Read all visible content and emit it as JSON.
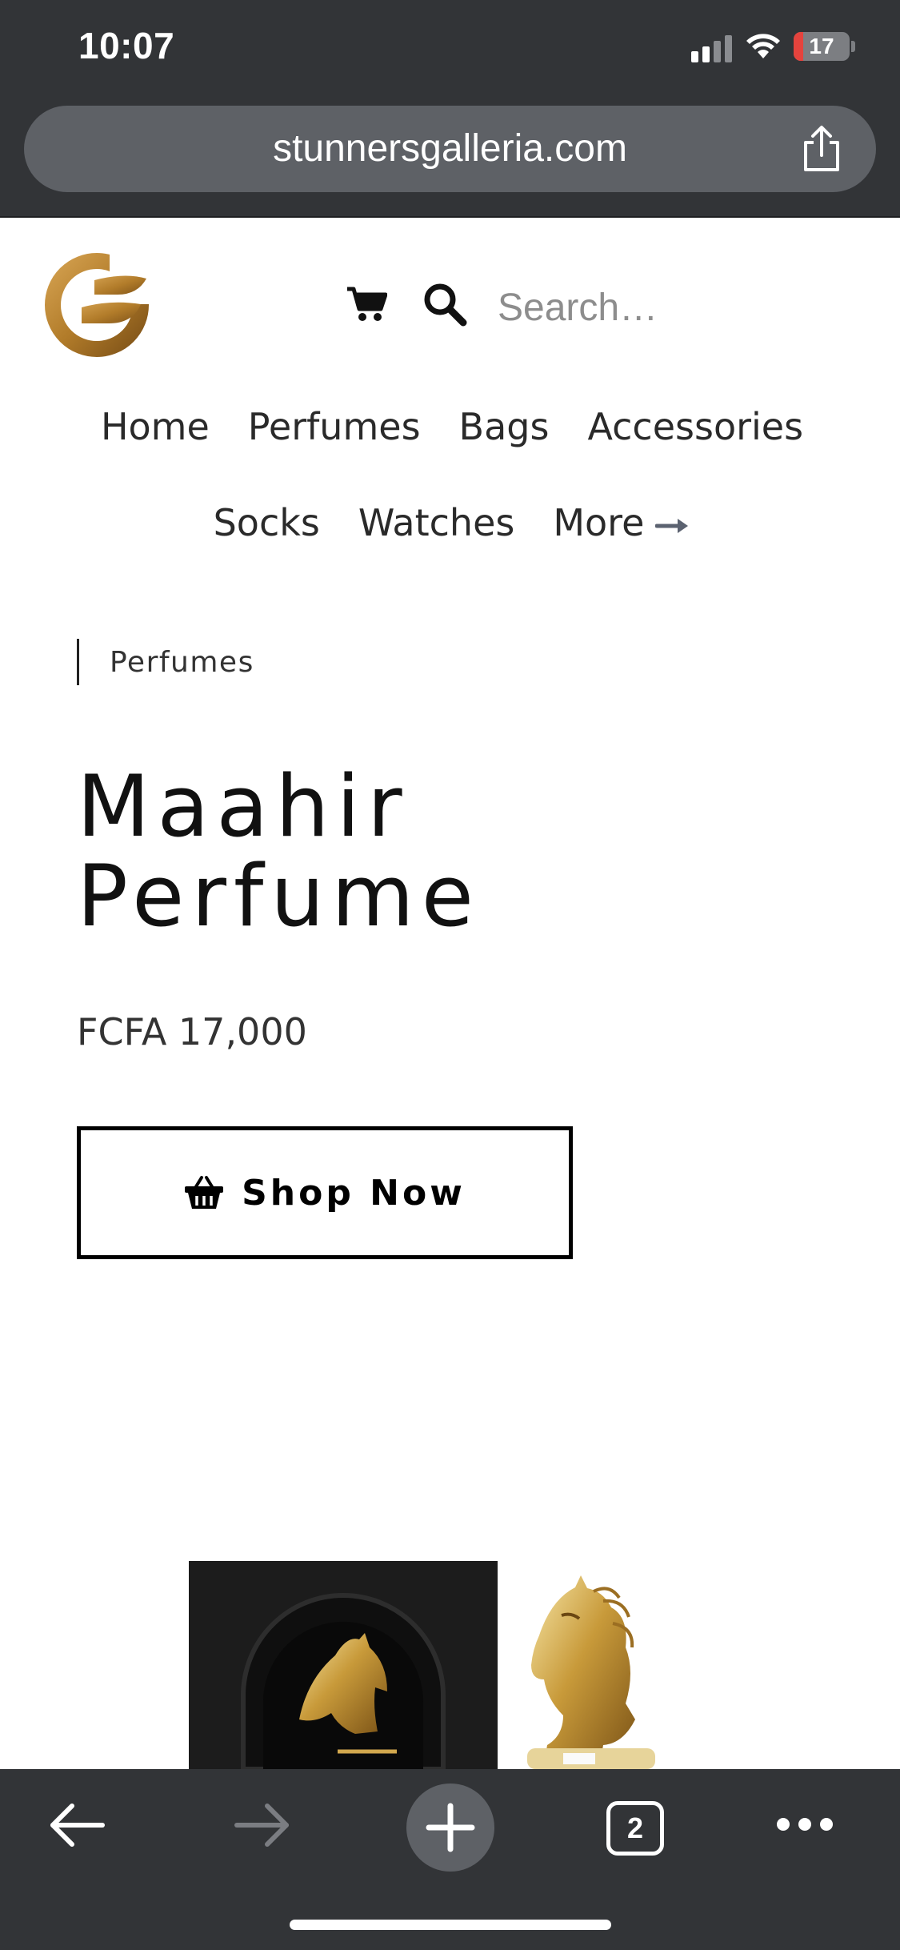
{
  "status_bar": {
    "time": "10:07",
    "battery_level": "17",
    "battery_fraction": 0.17,
    "signal_bars_active": 2,
    "signal_bars_total": 4
  },
  "browser": {
    "url": "stunnersgalleria.com",
    "open_tabs_count": "2",
    "icons": {
      "share": "share-icon",
      "back": "back-arrow-icon",
      "forward": "forward-arrow-icon",
      "new_tab": "plus-icon",
      "tabs": "tabs-icon",
      "more": "more-dots-icon"
    }
  },
  "site": {
    "brand_color": "#b27c2a",
    "search": {
      "placeholder": "Search…",
      "value": ""
    },
    "icons": {
      "cart": "cart-icon",
      "search": "search-icon",
      "logo": "logo-icon"
    },
    "nav": {
      "row1": [
        "Home",
        "Perfumes",
        "Bags",
        "Accessories"
      ],
      "row2": [
        "Socks",
        "Watches",
        "More"
      ]
    }
  },
  "product": {
    "category": "Perfumes",
    "title": "Maahir Perfume",
    "price": "FCFA 17,000",
    "cta_label": "Shop Now",
    "images": [
      "perfume-box-image",
      "perfume-bottle-image"
    ]
  }
}
